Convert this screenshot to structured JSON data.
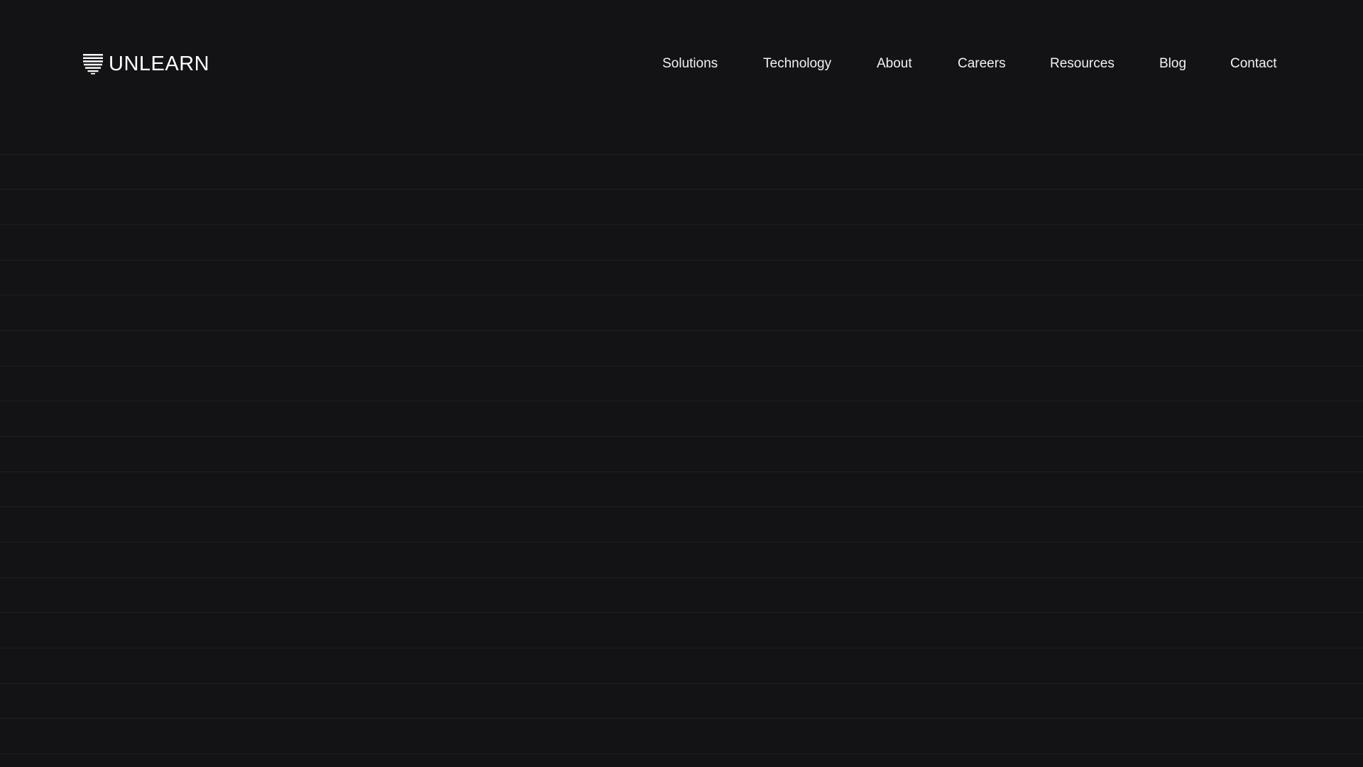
{
  "brand": {
    "name": "UNLEARN",
    "logo_icon": "striped-shield-icon"
  },
  "nav": {
    "items": [
      {
        "label": "Solutions"
      },
      {
        "label": "Technology"
      },
      {
        "label": "About"
      },
      {
        "label": "Careers"
      },
      {
        "label": "Resources"
      },
      {
        "label": "Blog"
      },
      {
        "label": "Contact"
      }
    ]
  },
  "colors": {
    "background": "#131316",
    "grid_line": "#1e1f23",
    "text": "#ffffff"
  }
}
